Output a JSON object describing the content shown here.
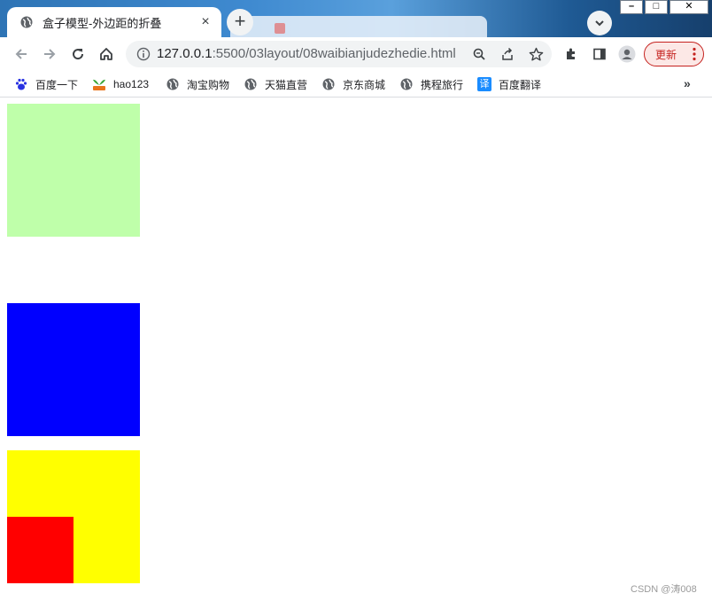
{
  "browser": {
    "tab": {
      "title": "盒子模型-外边距的折叠",
      "close_glyph": "×",
      "favicon": "globe-icon"
    },
    "new_tab_glyph": "+",
    "tab_search_icon": "chevron-down-icon",
    "window_controls": {
      "minimize": "–",
      "maximize": "□",
      "close": "✕"
    },
    "address": {
      "host": "127.0.0.1",
      "path": ":5500/03layout/08waibianjudezhedie.html",
      "icons": [
        "info-icon",
        "zoom-icon",
        "share-icon",
        "star-icon"
      ]
    },
    "toolbar_icons": [
      "back-icon",
      "forward-icon",
      "reload-icon",
      "home-icon",
      "extensions-icon",
      "side-panel-icon",
      "profile-icon"
    ],
    "update_button": {
      "label": "更新"
    },
    "bookmarks": [
      {
        "label": "百度一下",
        "icon": "baidu-paw-icon"
      },
      {
        "label": "hao123",
        "icon": "hao123-icon"
      },
      {
        "label": "淘宝购物",
        "icon": "globe-icon"
      },
      {
        "label": "天猫直营",
        "icon": "globe-icon"
      },
      {
        "label": "京东商城",
        "icon": "globe-icon"
      },
      {
        "label": "携程旅行",
        "icon": "globe-icon"
      },
      {
        "label": "百度翻译",
        "icon": "translate-icon",
        "icon_text": "译"
      }
    ],
    "bookmarks_more": "»"
  },
  "page": {
    "boxes": [
      {
        "name": "green-box",
        "color": "#bfffaa"
      },
      {
        "name": "blue-box",
        "color": "#0000ff"
      },
      {
        "name": "yellow-box",
        "color": "#ffff00"
      },
      {
        "name": "red-box",
        "color": "#ff0000"
      }
    ],
    "watermark": "CSDN @涛008"
  },
  "colors": {
    "accent_update": "#c5221f",
    "omnibox_bg": "#f1f3f4"
  }
}
